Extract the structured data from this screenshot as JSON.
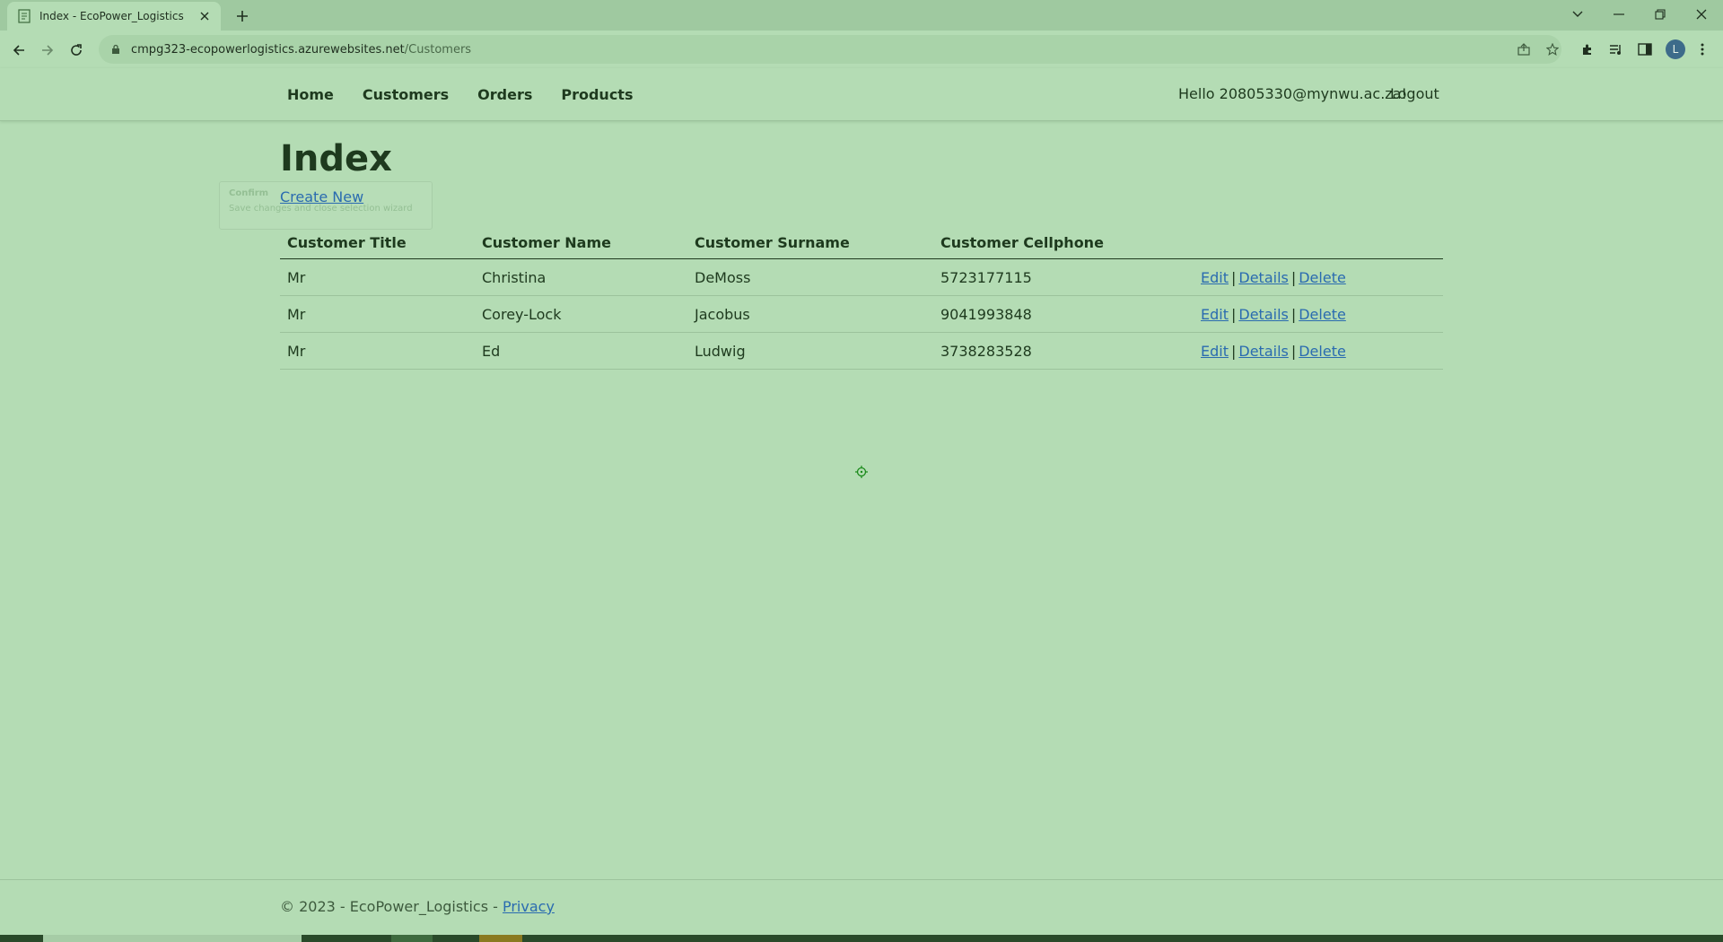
{
  "browser": {
    "tab_title": "Index - EcoPower_Logistics",
    "url_host": "cmpg323-ecopowerlogistics.azurewebsites.net",
    "url_path": "/Customers",
    "profile_initial": "L"
  },
  "nav": {
    "links": [
      "Home",
      "Customers",
      "Orders",
      "Products"
    ],
    "greeting": "Hello 20805330@mynwu.ac.za!",
    "logout": "Logout"
  },
  "page": {
    "title": "Index",
    "create_new": "Create New",
    "ghost_tooltip_title": "Confirm",
    "ghost_tooltip_text": "Save changes and close selection wizard"
  },
  "table": {
    "columns": [
      "Customer Title",
      "Customer Name",
      "Customer Surname",
      "Customer Cellphone"
    ],
    "rows": [
      {
        "title": "Mr",
        "name": "Christina",
        "surname": "DeMoss",
        "cellphone": "5723177115"
      },
      {
        "title": "Mr",
        "name": "Corey-Lock",
        "surname": "Jacobus",
        "cellphone": "9041993848"
      },
      {
        "title": "Mr",
        "name": "Ed",
        "surname": "Ludwig",
        "cellphone": "3738283528"
      }
    ],
    "actions": {
      "edit": "Edit",
      "details": "Details",
      "delete": "Delete",
      "separator": "|"
    }
  },
  "footer": {
    "copyright": "© 2023 - EcoPower_Logistics - ",
    "privacy": "Privacy"
  },
  "colors": {
    "background": "#b4dcb4",
    "text": "#1e3a1e",
    "link": "#2a6bb0",
    "tabbar": "#9fc9a0"
  },
  "icons": [
    "page-favicon-icon",
    "close-icon",
    "plus-icon",
    "chevron-down-icon",
    "minimize-icon",
    "restore-icon",
    "window-close-icon",
    "back-arrow-icon",
    "forward-arrow-icon",
    "reload-icon",
    "lock-icon",
    "share-icon",
    "star-icon",
    "extensions-icon",
    "media-icon",
    "side-panel-icon",
    "kebab-menu-icon",
    "crosshair-cursor-icon"
  ]
}
